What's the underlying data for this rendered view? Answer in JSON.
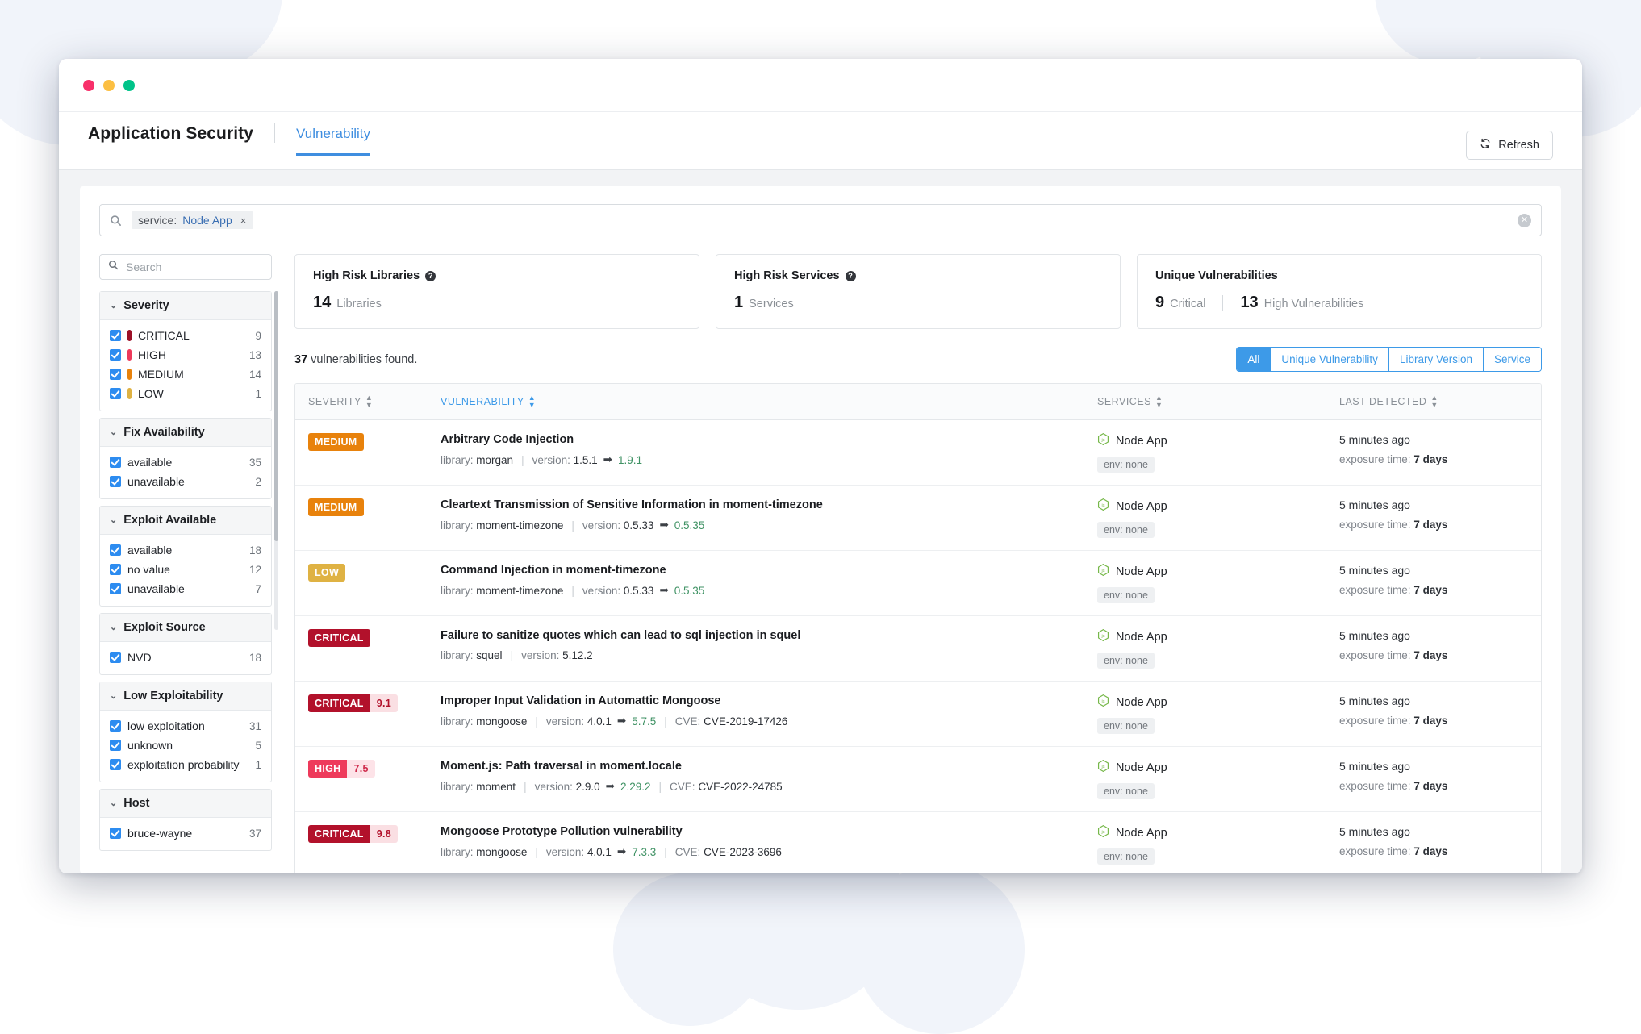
{
  "window": {
    "dots": [
      "close",
      "minimize",
      "maximize"
    ]
  },
  "header": {
    "app_title": "Application Security",
    "tab_label": "Vulnerability",
    "refresh_label": "Refresh",
    "refresh_icon": "refresh-icon"
  },
  "query": {
    "search_icon": "search-icon",
    "chip_key": "service:",
    "chip_value": "Node App",
    "chip_remove": "×",
    "clear_icon": "✕"
  },
  "sidebar": {
    "search_placeholder": "Search",
    "search_value": "",
    "facets": [
      {
        "title": "Severity",
        "rows": [
          {
            "label": "CRITICAL",
            "count": "9",
            "color": "#9c1128"
          },
          {
            "label": "HIGH",
            "count": "13",
            "color": "#ee3a5b"
          },
          {
            "label": "MEDIUM",
            "count": "14",
            "color": "#e8820c"
          },
          {
            "label": "LOW",
            "count": "1",
            "color": "#dfb243"
          }
        ]
      },
      {
        "title": "Fix Availability",
        "rows": [
          {
            "label": "available",
            "count": "35"
          },
          {
            "label": "unavailable",
            "count": "2"
          }
        ]
      },
      {
        "title": "Exploit Available",
        "rows": [
          {
            "label": "available",
            "count": "18"
          },
          {
            "label": "no value",
            "count": "12"
          },
          {
            "label": "unavailable",
            "count": "7"
          }
        ]
      },
      {
        "title": "Exploit Source",
        "rows": [
          {
            "label": "NVD",
            "count": "18"
          }
        ]
      },
      {
        "title": "Low Exploitability",
        "rows": [
          {
            "label": "low exploitation",
            "count": "31"
          },
          {
            "label": "unknown",
            "count": "5"
          },
          {
            "label": "exploitation probability",
            "count": "1"
          }
        ]
      },
      {
        "title": "Host",
        "rows": [
          {
            "label": "bruce-wayne",
            "count": "37"
          }
        ]
      }
    ]
  },
  "cards": [
    {
      "title": "High Risk Libraries",
      "help": true,
      "value": "14",
      "unit": "Libraries"
    },
    {
      "title": "High Risk Services",
      "help": true,
      "value": "1",
      "unit": "Services"
    },
    {
      "title": "Unique Vulnerabilities",
      "help": false,
      "value": "9",
      "unit": "Critical",
      "value2": "13",
      "unit2": "High Vulnerabilities"
    }
  ],
  "toolbar": {
    "count": "37",
    "found_text": "vulnerabilities found.",
    "segments": [
      {
        "label": "All",
        "active": true
      },
      {
        "label": "Unique Vulnerability",
        "active": false
      },
      {
        "label": "Library Version",
        "active": false
      },
      {
        "label": "Service",
        "active": false
      }
    ]
  },
  "table": {
    "columns": [
      {
        "label": "SEVERITY",
        "sorted": false
      },
      {
        "label": "VULNERABILITY",
        "sorted": true
      },
      {
        "label": "SERVICES",
        "sorted": false
      },
      {
        "label": "LAST DETECTED",
        "sorted": false
      }
    ],
    "labels": {
      "library": "library:",
      "version": "version:",
      "cve": "CVE:",
      "arrow": "➡",
      "env": "env: none",
      "exposure": "exposure time:"
    },
    "rows": [
      {
        "severity": "MEDIUM",
        "severity_class": "b-medium",
        "score": "",
        "title": "Arbitrary Code Injection",
        "library": "morgan",
        "version": "1.5.1",
        "fix_version": "1.9.1",
        "cve": "",
        "service": "Node App",
        "service_icon": "nodejs-icon",
        "env": "env: none",
        "detected": "5 minutes ago",
        "exposure": "7 days"
      },
      {
        "severity": "MEDIUM",
        "severity_class": "b-medium",
        "score": "",
        "title": "Cleartext Transmission of Sensitive Information in moment-timezone",
        "library": "moment-timezone",
        "version": "0.5.33",
        "fix_version": "0.5.35",
        "cve": "",
        "service": "Node App",
        "service_icon": "nodejs-icon",
        "env": "env: none",
        "detected": "5 minutes ago",
        "exposure": "7 days"
      },
      {
        "severity": "LOW",
        "severity_class": "b-low",
        "score": "",
        "title": "Command Injection in moment-timezone",
        "library": "moment-timezone",
        "version": "0.5.33",
        "fix_version": "0.5.35",
        "cve": "",
        "service": "Node App",
        "service_icon": "nodejs-icon",
        "env": "env: none",
        "detected": "5 minutes ago",
        "exposure": "7 days"
      },
      {
        "severity": "CRITICAL",
        "severity_class": "b-critical",
        "score": "",
        "title": "Failure to sanitize quotes which can lead to sql injection in squel",
        "library": "squel",
        "version": "5.12.2",
        "fix_version": "",
        "cve": "",
        "service": "Node App",
        "service_icon": "nodejs-icon",
        "env": "env: none",
        "detected": "5 minutes ago",
        "exposure": "7 days"
      },
      {
        "severity": "CRITICAL",
        "severity_class": "b-critical",
        "score": "9.1",
        "title": "Improper Input Validation in Automattic Mongoose",
        "library": "mongoose",
        "version": "4.0.1",
        "fix_version": "5.7.5",
        "cve": "CVE-2019-17426",
        "service": "Node App",
        "service_icon": "nodejs-icon",
        "env": "env: none",
        "detected": "5 minutes ago",
        "exposure": "7 days"
      },
      {
        "severity": "HIGH",
        "severity_class": "b-high",
        "score": "7.5",
        "title": "Moment.js: Path traversal in moment.locale",
        "library": "moment",
        "version": "2.9.0",
        "fix_version": "2.29.2",
        "cve": "CVE-2022-24785",
        "service": "Node App",
        "service_icon": "nodejs-icon",
        "env": "env: none",
        "detected": "5 minutes ago",
        "exposure": "7 days"
      },
      {
        "severity": "CRITICAL",
        "severity_class": "b-critical",
        "score": "9.8",
        "title": "Mongoose Prototype Pollution vulnerability",
        "library": "mongoose",
        "version": "4.0.1",
        "fix_version": "7.3.3",
        "cve": "CVE-2023-3696",
        "service": "Node App",
        "service_icon": "nodejs-icon",
        "env": "env: none",
        "detected": "5 minutes ago",
        "exposure": "7 days"
      }
    ]
  }
}
